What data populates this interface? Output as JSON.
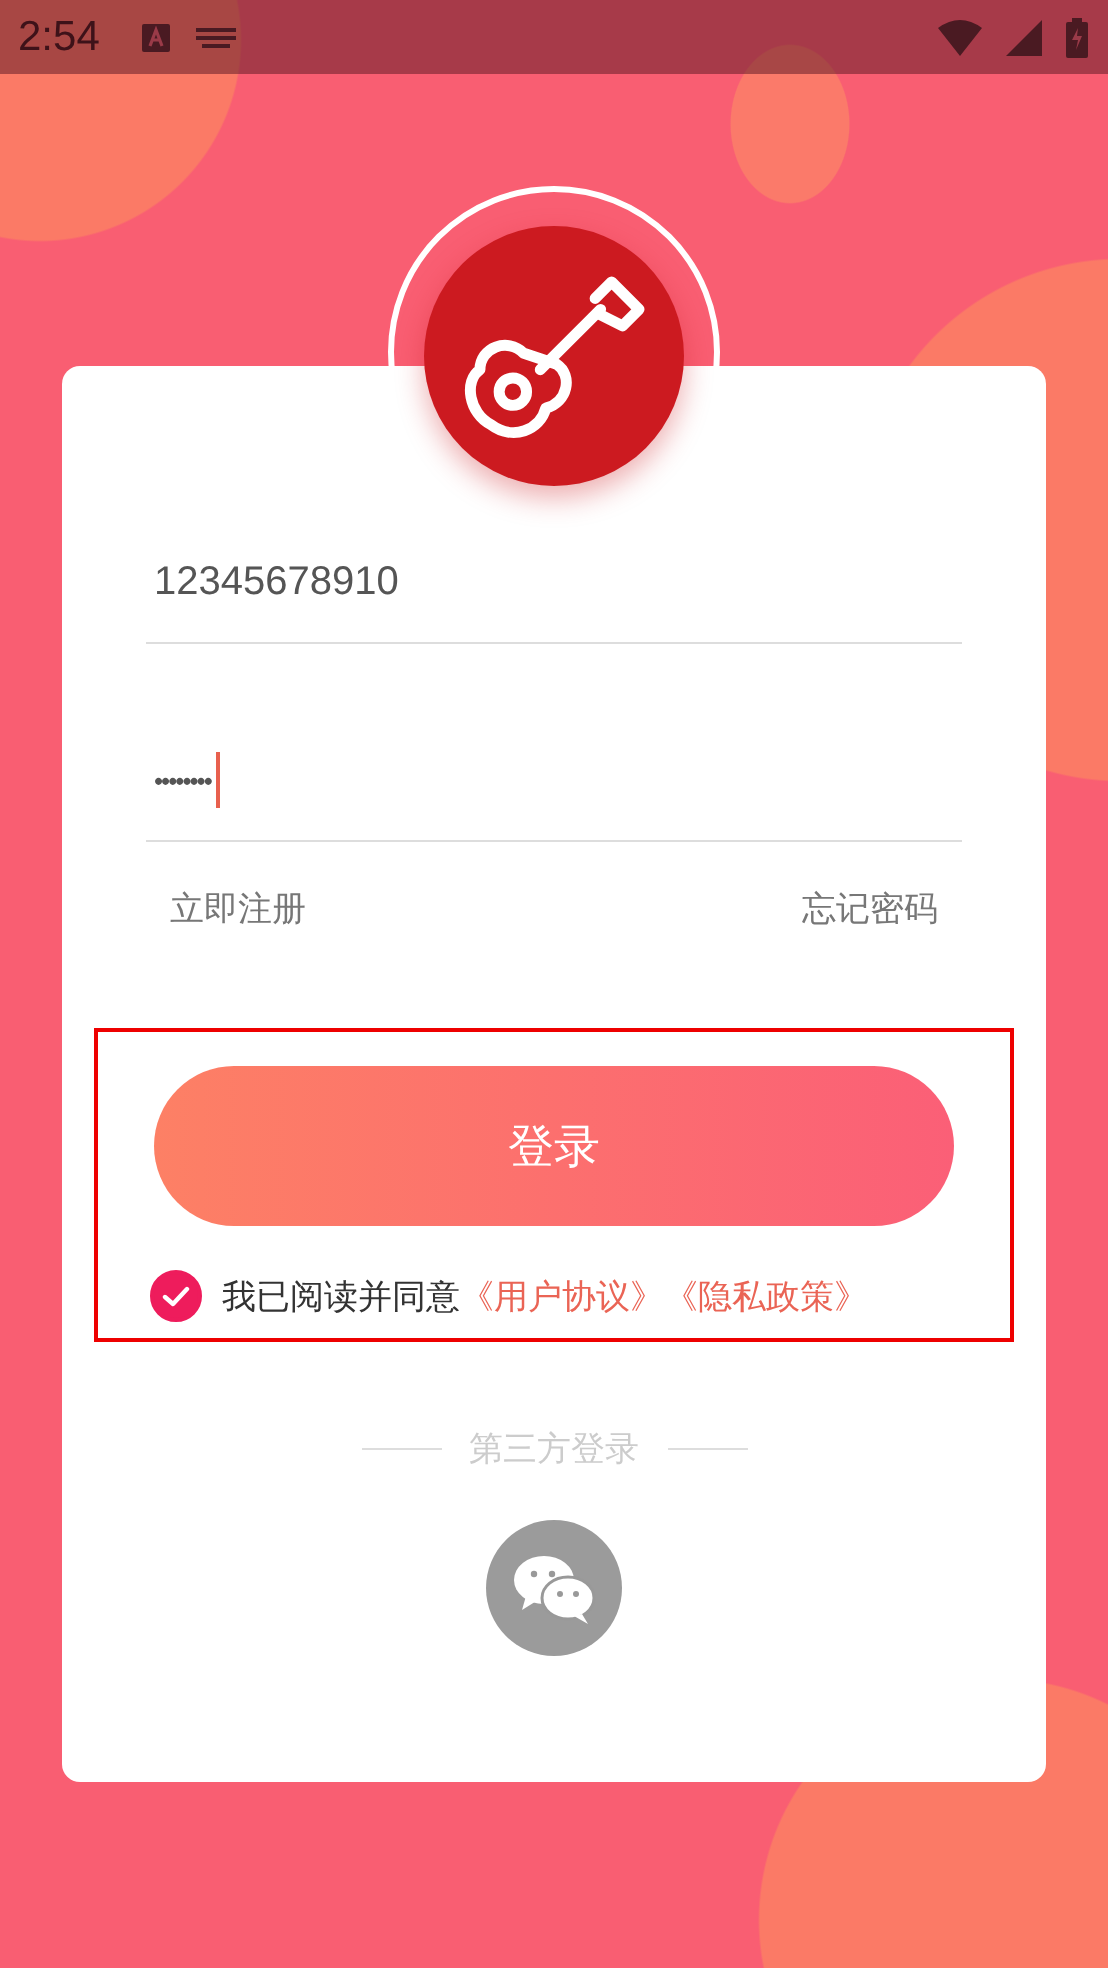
{
  "status_bar": {
    "time": "2:54"
  },
  "phone_field": {
    "value": "12345678910"
  },
  "password_field": {
    "value": "••••••••",
    "focused": true
  },
  "links": [
    {
      "label": "立即注册"
    },
    {
      "label": "忘记密码"
    }
  ],
  "login_button": {
    "label": "登录"
  },
  "agreement": {
    "checked": true,
    "text": "我已阅读并同意",
    "links": [
      "《用户协议》",
      "《隐私政策》"
    ]
  },
  "third_party": {
    "label": "第三方登录"
  }
}
